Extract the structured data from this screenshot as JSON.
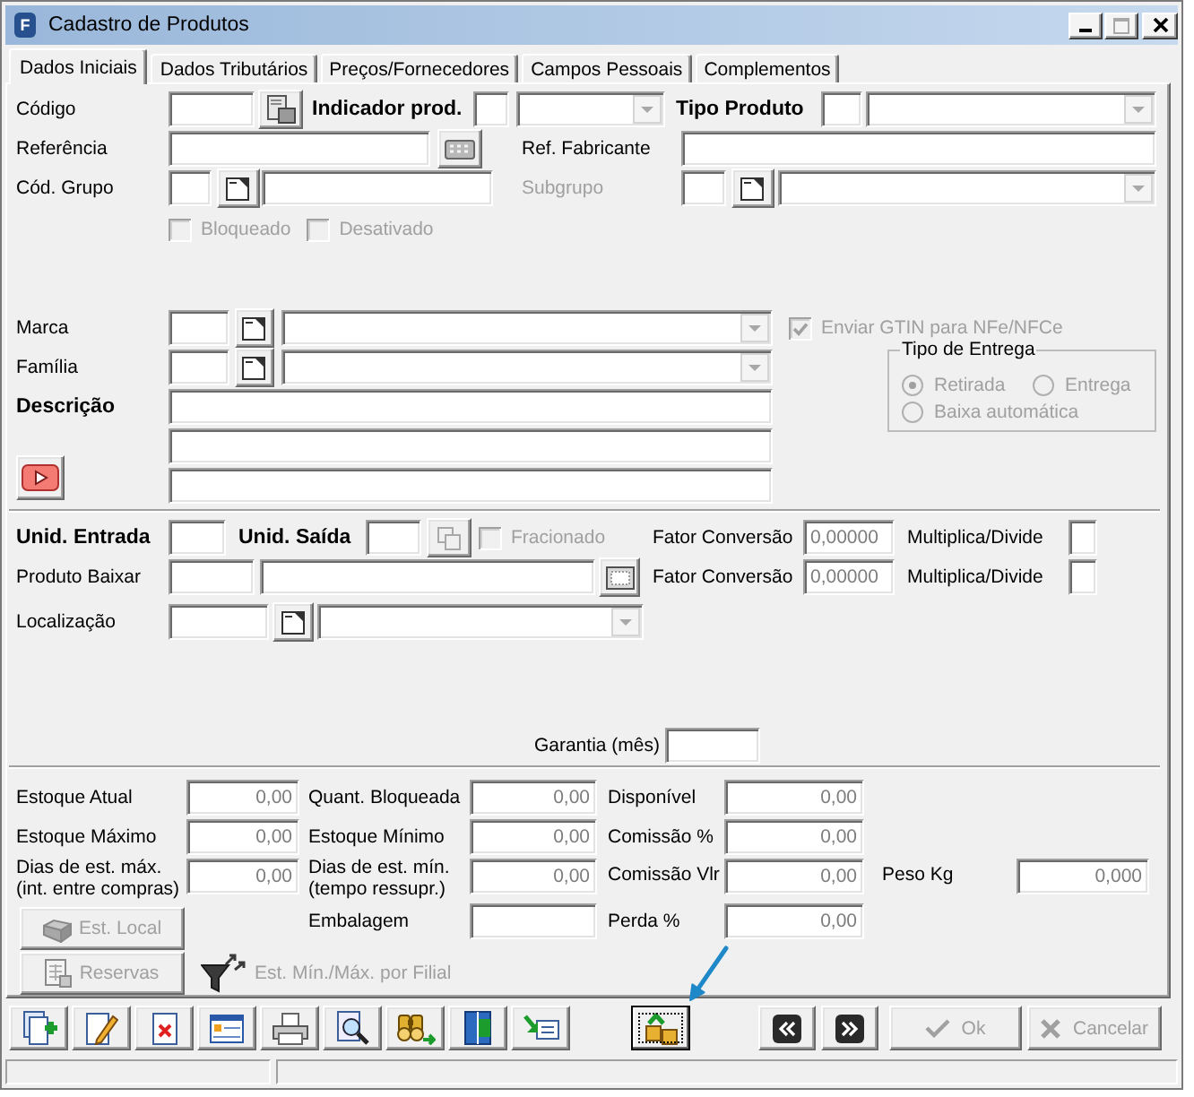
{
  "window": {
    "icon_text": "F",
    "title": "Cadastro de Produtos",
    "controls": [
      {
        "kind": "minimize",
        "disabled": false
      },
      {
        "kind": "maximize",
        "disabled": true
      },
      {
        "kind": "close",
        "disabled": false
      }
    ]
  },
  "tabs": [
    {
      "label": "Dados Iniciais",
      "selected": true
    },
    {
      "label": "Dados Tributários",
      "selected": false
    },
    {
      "label": "Preços/Fornecedores",
      "selected": false
    },
    {
      "label": "Campos Pessoais",
      "selected": false
    },
    {
      "label": "Complementos",
      "selected": false
    }
  ],
  "identification": {
    "codigo": {
      "label": "Código"
    },
    "indicador_prod": {
      "label": "Indicador prod."
    },
    "tipo_produto": {
      "label": "Tipo Produto"
    },
    "referencia": {
      "label": "Referência"
    },
    "ref_fabricante": {
      "label": "Ref. Fabricante"
    },
    "cod_grupo": {
      "label": "Cód. Grupo"
    },
    "subgrupo": {
      "label": "Subgrupo",
      "disabled": true
    },
    "flags": [
      {
        "label": "Bloqueado",
        "checked": false,
        "disabled": true
      },
      {
        "label": "Desativado",
        "checked": false,
        "disabled": true
      }
    ]
  },
  "classification": {
    "marca": {
      "label": "Marca"
    },
    "familia": {
      "label": "Família"
    },
    "descricao": {
      "label": "Descrição"
    },
    "enviar_gtin": {
      "label": "Enviar GTIN para NFe/NFCe",
      "checked": true,
      "disabled": true
    },
    "tipo_entrega": {
      "title": "Tipo de Entrega",
      "disabled": true,
      "options": [
        {
          "label": "Retirada",
          "selected": true
        },
        {
          "label": "Entrega",
          "selected": false
        },
        {
          "label": "Baixa automática",
          "selected": false
        }
      ]
    }
  },
  "units": {
    "unid_entrada": {
      "label": "Unid. Entrada"
    },
    "unid_saida": {
      "label": "Unid. Saída"
    },
    "fracionado": {
      "label": "Fracionado",
      "checked": false,
      "disabled": true
    },
    "produto_baixar": {
      "label": "Produto Baixar"
    },
    "conversions": [
      {
        "label": "Fator Conversão",
        "value": "0,00000",
        "mode_label": "Multiplica/Divide"
      },
      {
        "label": "Fator Conversão",
        "value": "0,00000",
        "mode_label": "Multiplica/Divide"
      }
    ],
    "localizacao": {
      "label": "Localização"
    },
    "garantia": {
      "label": "Garantia (mês)"
    }
  },
  "stock": {
    "rows": [
      [
        {
          "label": "Estoque Atual",
          "value": "0,00"
        },
        {
          "label": "Quant. Bloqueada",
          "value": "0,00"
        },
        {
          "label": "Disponível",
          "value": "0,00"
        }
      ],
      [
        {
          "label": "Estoque Máximo",
          "value": "0,00"
        },
        {
          "label": "Estoque Mínimo",
          "value": "0,00"
        },
        {
          "label": "Comissão %",
          "value": "0,00"
        }
      ],
      [
        {
          "label": "Dias de est. máx.\n(int. entre compras)",
          "value": "0,00"
        },
        {
          "label": "Dias de est. mín.\n(tempo ressupr.)",
          "value": "0,00"
        },
        {
          "label": "Comissão Vlr",
          "value": "0,00"
        },
        {
          "label": "Peso Kg",
          "value": "0,000"
        }
      ]
    ],
    "embalagem": {
      "label": "Embalagem"
    },
    "perda": {
      "label": "Perda %",
      "value": "0,00"
    },
    "buttons": [
      {
        "label": "Est. Local",
        "disabled": true
      },
      {
        "label": "Reservas",
        "disabled": true
      }
    ],
    "filial_link": {
      "label": "Est. Mín./Máx. por Filial",
      "disabled": true
    }
  },
  "toolbar": {
    "tools": [
      {
        "kind": "add",
        "focused": false
      },
      {
        "kind": "edit",
        "focused": false
      },
      {
        "kind": "delete",
        "focused": false
      },
      {
        "kind": "form",
        "focused": false
      },
      {
        "kind": "print",
        "focused": false
      },
      {
        "kind": "preview",
        "focused": false
      },
      {
        "kind": "find",
        "focused": false
      },
      {
        "kind": "exit",
        "focused": false
      },
      {
        "kind": "import",
        "focused": false
      }
    ],
    "extra_tools": [
      {
        "kind": "transfer",
        "focused": true
      }
    ],
    "navigation": [
      {
        "kind": "previous"
      },
      {
        "kind": "next"
      }
    ],
    "actions": [
      {
        "label": "Ok",
        "kind": "confirm",
        "disabled": true
      },
      {
        "label": "Cancelar",
        "kind": "cancel",
        "disabled": true
      }
    ]
  }
}
